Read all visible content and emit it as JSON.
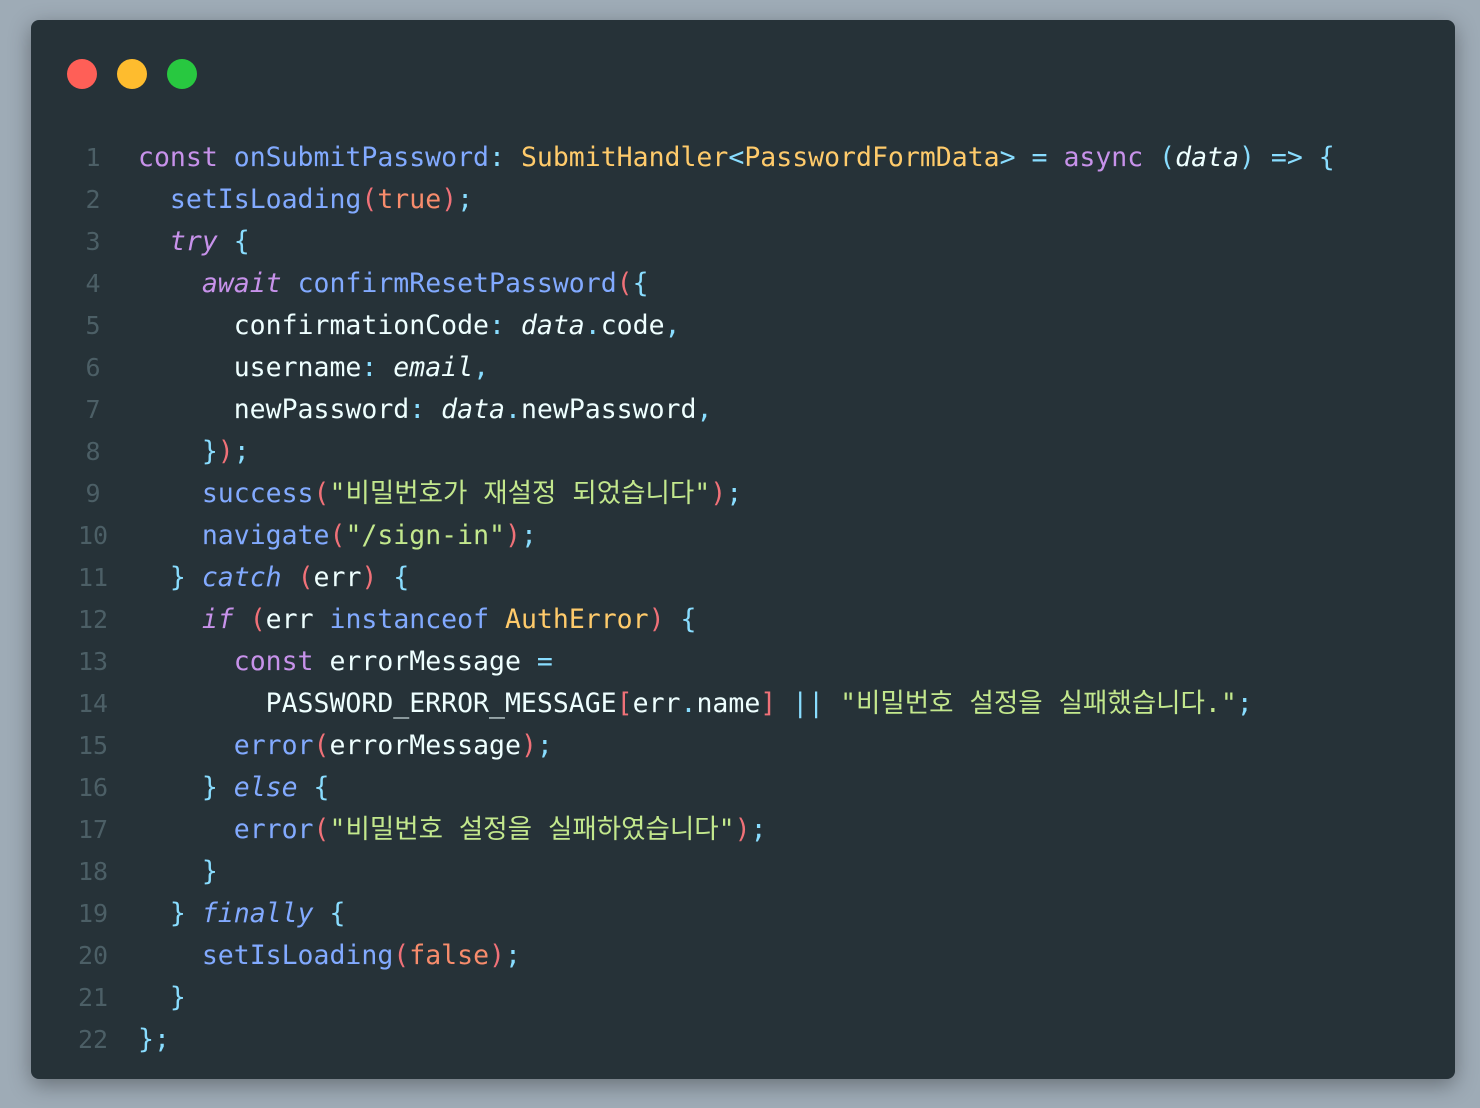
{
  "window": {
    "controls": [
      "close",
      "minimize",
      "maximize"
    ],
    "colors": {
      "close": "#ff5f57",
      "minimize": "#febc2e",
      "maximize": "#28c840",
      "background": "#263238"
    }
  },
  "code": {
    "language": "TypeScript",
    "lines": [
      {
        "n": "1",
        "tokens": [
          [
            "kw",
            "const "
          ],
          [
            "fn",
            "onSubmitPassword"
          ],
          [
            "pu",
            ": "
          ],
          [
            "ty",
            "SubmitHandler"
          ],
          [
            "pu",
            "<"
          ],
          [
            "ty",
            "PasswordFormData"
          ],
          [
            "pu",
            "> = "
          ],
          [
            "kw",
            "async "
          ],
          [
            "pu",
            "("
          ],
          [
            "vi",
            "data"
          ],
          [
            "pu",
            ") => {"
          ]
        ]
      },
      {
        "n": "2",
        "tokens": [
          [
            "va",
            "  "
          ],
          [
            "fn",
            "setIsLoading"
          ],
          [
            "br",
            "("
          ],
          [
            "bo",
            "true"
          ],
          [
            "br",
            ")"
          ],
          [
            "pu",
            ";"
          ]
        ]
      },
      {
        "n": "3",
        "tokens": [
          [
            "va",
            "  "
          ],
          [
            "it",
            "try"
          ],
          [
            "pu",
            " {"
          ]
        ]
      },
      {
        "n": "4",
        "tokens": [
          [
            "va",
            "    "
          ],
          [
            "it",
            "await "
          ],
          [
            "fn",
            "confirmResetPassword"
          ],
          [
            "br",
            "("
          ],
          [
            "pu",
            "{"
          ]
        ]
      },
      {
        "n": "5",
        "tokens": [
          [
            "va",
            "      confirmationCode"
          ],
          [
            "pu",
            ": "
          ],
          [
            "vi",
            "data"
          ],
          [
            "pu",
            "."
          ],
          [
            "va",
            "code"
          ],
          [
            "pu",
            ","
          ]
        ]
      },
      {
        "n": "6",
        "tokens": [
          [
            "va",
            "      username"
          ],
          [
            "pu",
            ": "
          ],
          [
            "vi",
            "email"
          ],
          [
            "pu",
            ","
          ]
        ]
      },
      {
        "n": "7",
        "tokens": [
          [
            "va",
            "      newPassword"
          ],
          [
            "pu",
            ": "
          ],
          [
            "vi",
            "data"
          ],
          [
            "pu",
            "."
          ],
          [
            "va",
            "newPassword"
          ],
          [
            "pu",
            ","
          ]
        ]
      },
      {
        "n": "8",
        "tokens": [
          [
            "va",
            "    "
          ],
          [
            "pu",
            "}"
          ],
          [
            "br",
            ")"
          ],
          [
            "pu",
            ";"
          ]
        ]
      },
      {
        "n": "9",
        "tokens": [
          [
            "va",
            "    "
          ],
          [
            "fn",
            "success"
          ],
          [
            "br",
            "("
          ],
          [
            "st",
            "\"비밀번호가 재설정 되었습니다\""
          ],
          [
            "br",
            ")"
          ],
          [
            "pu",
            ";"
          ]
        ]
      },
      {
        "n": "10",
        "tokens": [
          [
            "va",
            "    "
          ],
          [
            "fn",
            "navigate"
          ],
          [
            "br",
            "("
          ],
          [
            "st",
            "\"/sign-in\""
          ],
          [
            "br",
            ")"
          ],
          [
            "pu",
            ";"
          ]
        ]
      },
      {
        "n": "11",
        "tokens": [
          [
            "va",
            "  "
          ],
          [
            "pu",
            "} "
          ],
          [
            "it2",
            "catch "
          ],
          [
            "br",
            "("
          ],
          [
            "va",
            "err"
          ],
          [
            "br",
            ")"
          ],
          [
            "pu",
            " {"
          ]
        ]
      },
      {
        "n": "12",
        "tokens": [
          [
            "va",
            "    "
          ],
          [
            "it",
            "if "
          ],
          [
            "br",
            "("
          ],
          [
            "va",
            "err "
          ],
          [
            "fn",
            "instanceof "
          ],
          [
            "ty",
            "AuthError"
          ],
          [
            "br",
            ")"
          ],
          [
            "pu",
            " {"
          ]
        ]
      },
      {
        "n": "13",
        "tokens": [
          [
            "va",
            "      "
          ],
          [
            "kw",
            "const "
          ],
          [
            "va",
            "errorMessage "
          ],
          [
            "pu",
            "="
          ]
        ]
      },
      {
        "n": "14",
        "tokens": [
          [
            "va",
            "        PASSWORD_ERROR_MESSAGE"
          ],
          [
            "br",
            "["
          ],
          [
            "va",
            "err"
          ],
          [
            "pu",
            "."
          ],
          [
            "va",
            "name"
          ],
          [
            "br",
            "]"
          ],
          [
            "pu",
            " || "
          ],
          [
            "st",
            "\"비밀번호 설정을 실패했습니다.\""
          ],
          [
            "pu",
            ";"
          ]
        ]
      },
      {
        "n": "15",
        "tokens": [
          [
            "va",
            "      "
          ],
          [
            "fn",
            "error"
          ],
          [
            "br",
            "("
          ],
          [
            "va",
            "errorMessage"
          ],
          [
            "br",
            ")"
          ],
          [
            "pu",
            ";"
          ]
        ]
      },
      {
        "n": "16",
        "tokens": [
          [
            "va",
            "    "
          ],
          [
            "pu",
            "} "
          ],
          [
            "it2",
            "else"
          ],
          [
            "pu",
            " {"
          ]
        ]
      },
      {
        "n": "17",
        "tokens": [
          [
            "va",
            "      "
          ],
          [
            "fn",
            "error"
          ],
          [
            "br",
            "("
          ],
          [
            "st",
            "\"비밀번호 설정을 실패하였습니다\""
          ],
          [
            "br",
            ")"
          ],
          [
            "pu",
            ";"
          ]
        ]
      },
      {
        "n": "18",
        "tokens": [
          [
            "va",
            "    "
          ],
          [
            "pu",
            "}"
          ]
        ]
      },
      {
        "n": "19",
        "tokens": [
          [
            "va",
            "  "
          ],
          [
            "pu",
            "} "
          ],
          [
            "it2",
            "finally"
          ],
          [
            "pu",
            " {"
          ]
        ]
      },
      {
        "n": "20",
        "tokens": [
          [
            "va",
            "    "
          ],
          [
            "fn",
            "setIsLoading"
          ],
          [
            "br",
            "("
          ],
          [
            "bo",
            "false"
          ],
          [
            "br",
            ")"
          ],
          [
            "pu",
            ";"
          ]
        ]
      },
      {
        "n": "21",
        "tokens": [
          [
            "va",
            "  "
          ],
          [
            "pu",
            "}"
          ]
        ]
      },
      {
        "n": "22",
        "tokens": [
          [
            "pu",
            "};"
          ]
        ]
      }
    ]
  }
}
